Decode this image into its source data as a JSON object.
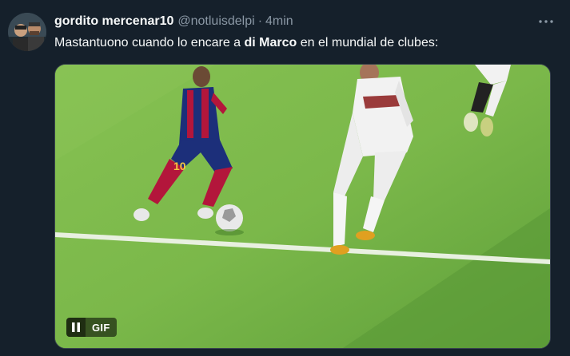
{
  "tweet": {
    "author_name": "gordito mercenar10",
    "handle": "@notluisdelpi",
    "separator": "·",
    "time": "4min",
    "text_before": "Mastantuono cuando lo encare a ",
    "text_bold": "di Marco",
    "text_after": " en el mundial de clubes:"
  },
  "media": {
    "badge": "GIF",
    "player_number": "10"
  },
  "colors": {
    "background": "#15202b",
    "pitch": "#78b547",
    "text_primary": "#f7f9f9",
    "text_secondary": "#8b98a5"
  },
  "icons": {
    "more": "more-options-icon",
    "pause": "pause-icon"
  }
}
